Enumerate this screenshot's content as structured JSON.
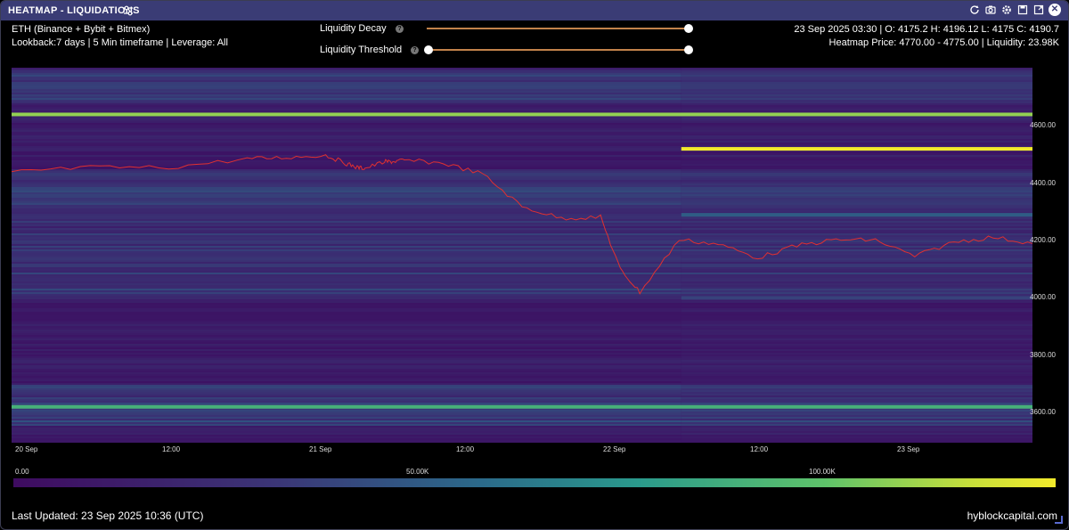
{
  "window": {
    "title": "HEATMAP - LIQUIDATIONS",
    "toolbar_icons": [
      "refresh-icon",
      "camera-icon",
      "settings-icon",
      "save-icon",
      "expand-icon",
      "close-icon"
    ]
  },
  "info_left": {
    "exchange": "ETH (Binance + Bybit + Bitmex)",
    "lookback": "Lookback:7 days | 5 Min timeframe | Leverage: All"
  },
  "info_right": {
    "ohlc": "23 Sep 2025 03:30 | O: 4175.2 H: 4196.12 L: 4175 C: 4190.7",
    "heatmap_price": "Heatmap Price: 4770.00 - 4775.00 | Liquidity: 23.98K"
  },
  "sliders": {
    "decay": {
      "label": "Liquidity Decay",
      "value": 1.0
    },
    "threshold": {
      "label": "Liquidity Threshold",
      "min_value": 0.0,
      "max_value": 1.0
    }
  },
  "chart_data": {
    "type": "heatmap",
    "y_ticks": [
      "4600.00",
      "4400.00",
      "4200.00",
      "4000.00",
      "3800.00",
      "3600.00"
    ],
    "x_ticks": [
      "20 Sep",
      "12:00",
      "21 Sep",
      "12:00",
      "22 Sep",
      "12:00",
      "23 Sep"
    ],
    "ylim": [
      3495,
      4803
    ],
    "price_series": {
      "x_index": [
        0,
        20,
        40,
        60,
        70,
        80,
        85,
        88,
        90,
        95,
        97,
        100,
        110,
        120,
        130,
        140,
        150,
        155,
        160,
        170,
        180,
        190,
        200,
        210,
        220,
        230,
        240,
        250,
        260
      ],
      "price": [
        4440,
        4455,
        4455,
        4485,
        4490,
        4498,
        4470,
        4455,
        4452,
        4475,
        4475,
        4480,
        4470,
        4432,
        4318,
        4278,
        4282,
        4100,
        4020,
        4203,
        4188,
        4140,
        4182,
        4203,
        4202,
        4145,
        4195,
        4212,
        4190
      ]
    },
    "liquidity_levels": [
      {
        "price": 4640,
        "liquidity": 85,
        "x_from": 0.0,
        "x_to": 1.0
      },
      {
        "price": 4520,
        "liquidity": 100,
        "x_from": 0.656,
        "x_to": 1.0
      },
      {
        "price": 4290,
        "liquidity": 40,
        "x_from": 0.656,
        "x_to": 1.0
      },
      {
        "price": 4000,
        "liquidity": 30,
        "x_from": 0.656,
        "x_to": 1.0
      },
      {
        "price": 3620,
        "liquidity": 70,
        "x_from": 0.0,
        "x_to": 1.0
      }
    ],
    "colorbar": {
      "labels": [
        "0.00",
        "50.00K",
        "100.00K"
      ]
    }
  },
  "footer": {
    "updated": "Last Updated: 23 Sep 2025 10:36 (UTC)",
    "brand": "hyblockcapital.com"
  }
}
